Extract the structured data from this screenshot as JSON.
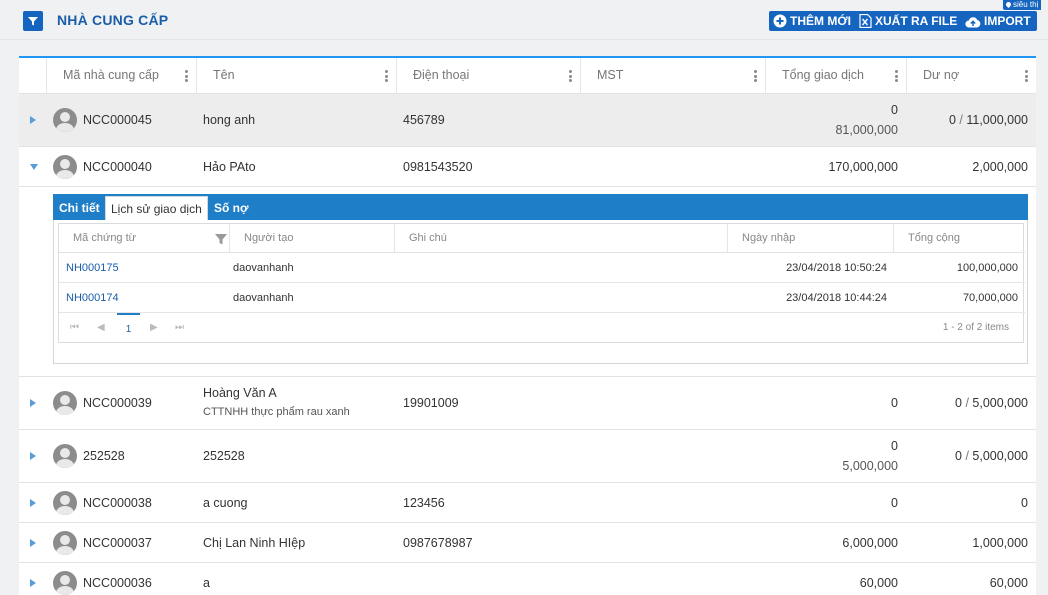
{
  "page": {
    "title": "NHÀ CUNG CẤP",
    "site_tag": "siêu thị",
    "buttons": {
      "add": "THÊM MỚI",
      "export": "XUẤT RA FILE",
      "import": "IMPORT"
    }
  },
  "columns": [
    "Mã nhà cung cấp",
    "Tên",
    "Điện thoại",
    "MST",
    "Tổng giao dịch",
    "Dư nợ"
  ],
  "suppliers": [
    {
      "code": "NCC000045",
      "name": "hong anh",
      "note": "",
      "phone": "456789",
      "total_top": "0",
      "total_bottom": "81,000,000",
      "debt_a": "0",
      "debt_sep": " / ",
      "debt_b": "11,000,000"
    },
    {
      "code": "NCC000040",
      "name": "Hảo PAto",
      "note": "",
      "phone": "0981543520",
      "total_top": "170,000,000",
      "total_bottom": "",
      "debt_a": "2,000,000",
      "debt_sep": "",
      "debt_b": ""
    },
    {
      "code": "NCC000039",
      "name": "Hoàng Văn A",
      "note": "CTTNHH thực phẩm rau xanh",
      "phone": "19901009",
      "total_top": "0",
      "total_bottom": "",
      "debt_a": "0",
      "debt_sep": " / ",
      "debt_b": "5,000,000"
    },
    {
      "code": "252528",
      "name": "252528",
      "note": "",
      "phone": "",
      "total_top": "0",
      "total_bottom": "5,000,000",
      "debt_a": "0",
      "debt_sep": " / ",
      "debt_b": "5,000,000"
    },
    {
      "code": "NCC000038",
      "name": "a cuong",
      "note": "",
      "phone": "123456",
      "total_top": "0",
      "total_bottom": "",
      "debt_a": "0",
      "debt_sep": "",
      "debt_b": ""
    },
    {
      "code": "NCC000037",
      "name": "Chị Lan Ninh HIệp",
      "note": "",
      "phone": "0987678987",
      "total_top": "6,000,000",
      "total_bottom": "",
      "debt_a": "1,000,000",
      "debt_sep": "",
      "debt_b": ""
    },
    {
      "code": "NCC000036",
      "name": "a",
      "note": "",
      "phone": "",
      "total_top": "60,000",
      "total_bottom": "",
      "debt_a": "60,000",
      "debt_sep": "",
      "debt_b": ""
    }
  ],
  "detail": {
    "tabs": [
      "Chi tiết",
      "Lịch sử giao dịch",
      "Số nợ"
    ],
    "selected_tab": "Lịch sử giao dịch",
    "columns": [
      "Mã chứng từ",
      "Người tạo",
      "Ghi chú",
      "Ngày nhập",
      "Tổng cộng"
    ],
    "rows": [
      {
        "doc": "NH000175",
        "creator": "daovanhanh",
        "note": "",
        "date": "23/04/2018 10:50:24",
        "total": "100,000,000"
      },
      {
        "doc": "NH000174",
        "creator": "daovanhanh",
        "note": "",
        "date": "23/04/2018 10:44:24",
        "total": "70,000,000"
      }
    ],
    "pager": {
      "current_page": "1",
      "info": "1 - 2 of 2 items"
    }
  },
  "colors": {
    "primary": "#1565c0",
    "tab_bar": "#1e7fc8",
    "accent_line": "#2196f3",
    "link": "#1a5da8"
  }
}
